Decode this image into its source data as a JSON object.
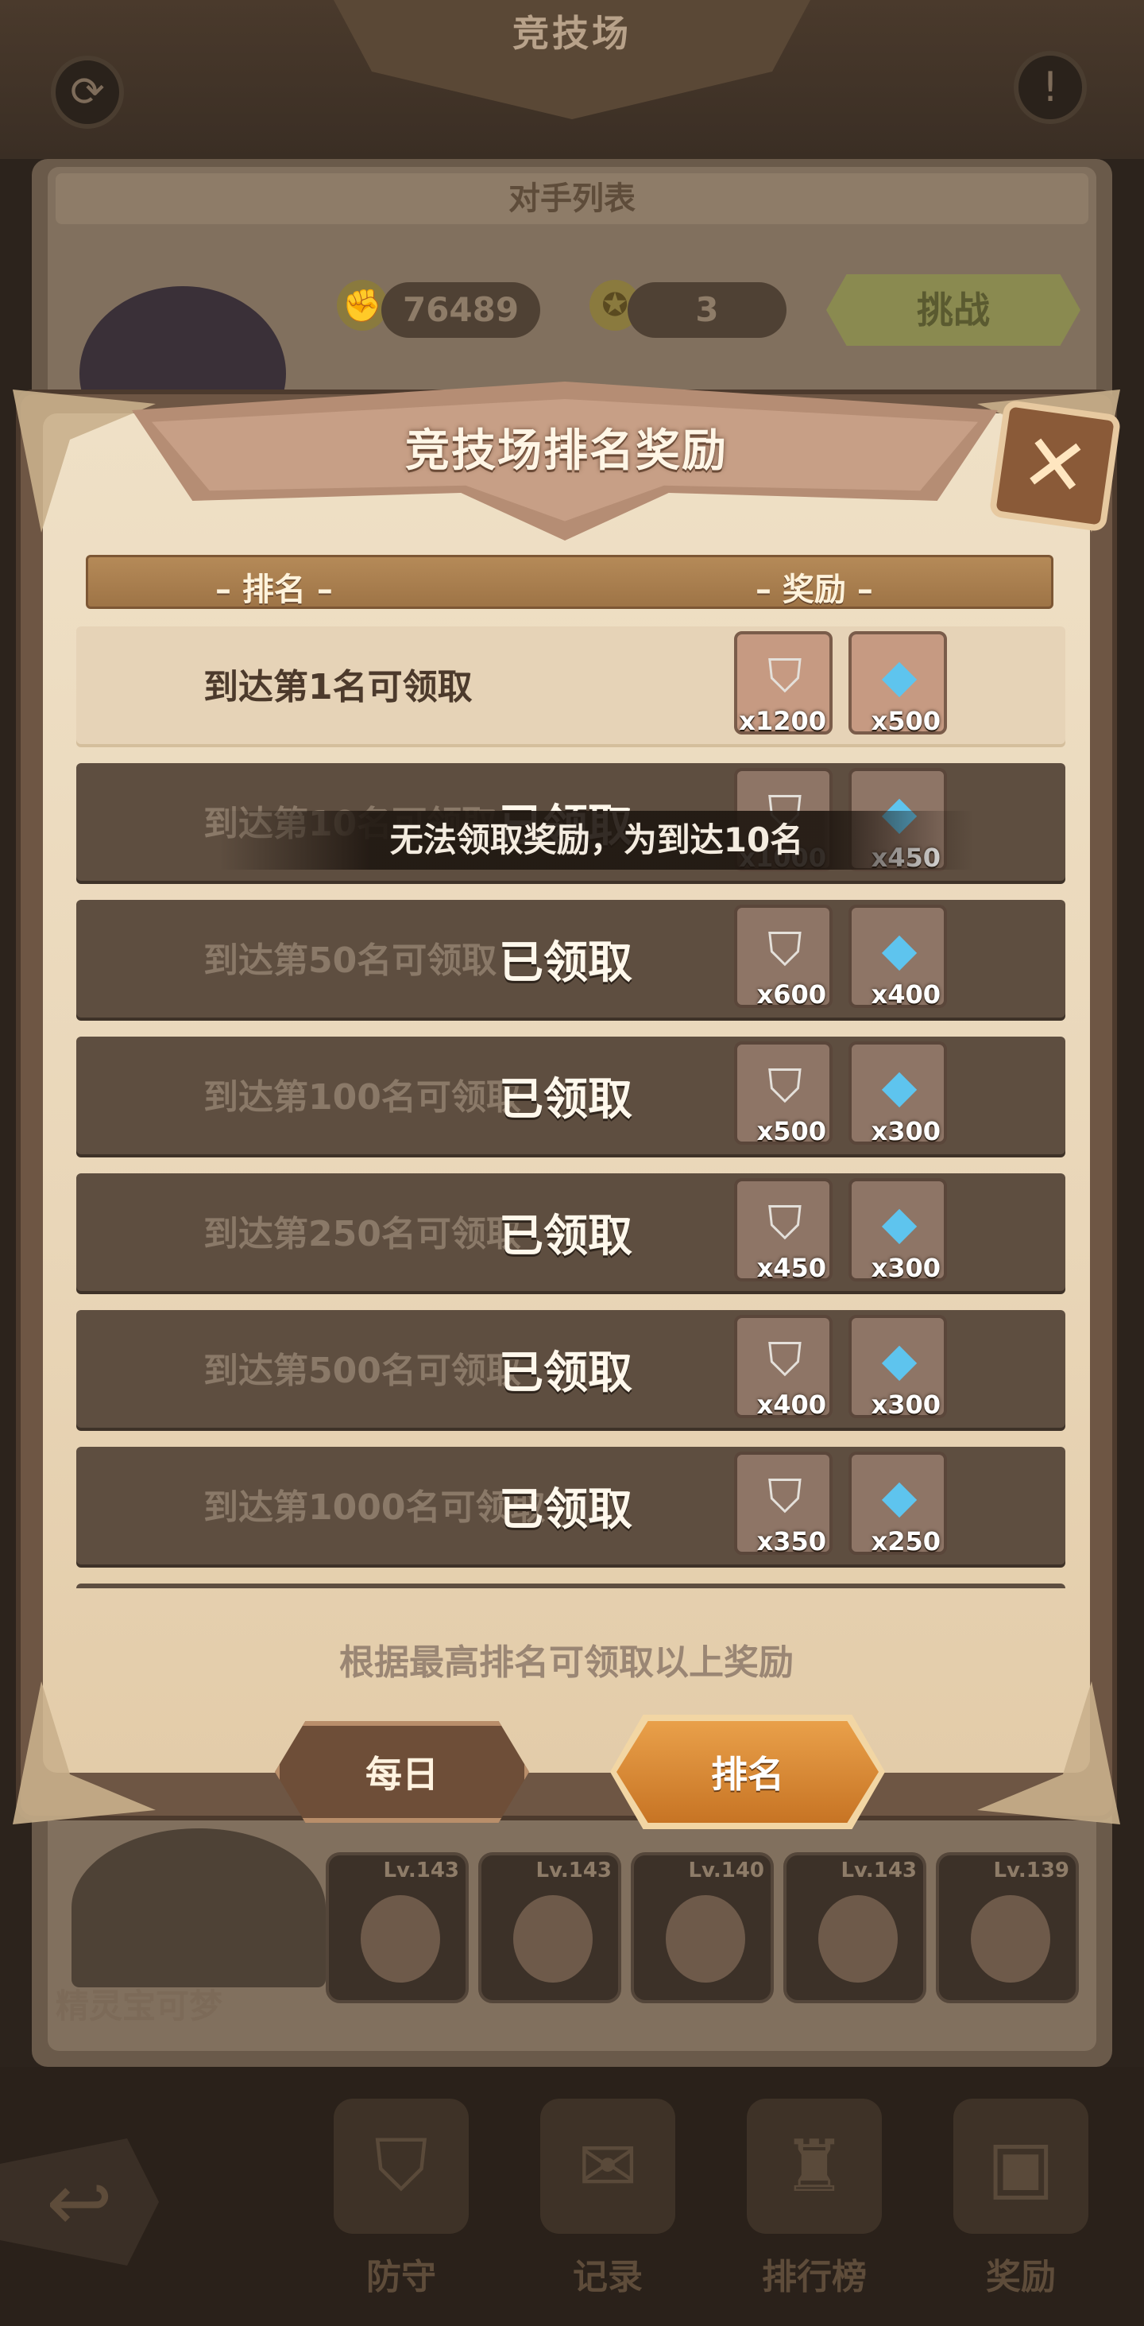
{
  "background": {
    "screen_title": "竞技场",
    "list_header": "对手列表",
    "power": "76489",
    "medals": "3",
    "challenge_label": "挑战",
    "hero_name": "精灵宝可梦",
    "heroes": [
      {
        "level": "Lv.143"
      },
      {
        "level": "Lv.143"
      },
      {
        "level": "Lv.140"
      },
      {
        "level": "Lv.143"
      },
      {
        "level": "Lv.139"
      }
    ],
    "nav": [
      {
        "label": "防守",
        "icon": "shield-icon"
      },
      {
        "label": "记录",
        "icon": "scroll-icon"
      },
      {
        "label": "排行榜",
        "icon": "trophy-icon"
      },
      {
        "label": "奖励",
        "icon": "chest-icon"
      }
    ]
  },
  "modal": {
    "title": "竞技场排名奖励",
    "col_rank": "– 排名 –",
    "col_reward": "– 奖励 –",
    "claimed_label": "已领取",
    "rows": [
      {
        "text": "到达第1名可领取",
        "status": "available",
        "r1": "x1200",
        "r2": "x500"
      },
      {
        "text": "到达第10名可领取",
        "status": "claimed",
        "r1": "x1000",
        "r2": "x450"
      },
      {
        "text": "到达第50名可领取",
        "status": "claimed",
        "r1": "x600",
        "r2": "x400"
      },
      {
        "text": "到达第100名可领取",
        "status": "claimed",
        "r1": "x500",
        "r2": "x300"
      },
      {
        "text": "到达第250名可领取",
        "status": "claimed",
        "r1": "x450",
        "r2": "x300"
      },
      {
        "text": "到达第500名可领取",
        "status": "claimed",
        "r1": "x400",
        "r2": "x300"
      },
      {
        "text": "到达第1000名可领取",
        "status": "claimed",
        "r1": "x350",
        "r2": "x250"
      }
    ],
    "toast": "无法领取奖励，为到达10名",
    "footnote": "根据最高排名可领取以上奖励",
    "tabs": {
      "daily": "每日",
      "rank": "排名"
    },
    "colors": {
      "accent": "#d7873a",
      "claimed_row": "#5e4e40",
      "available_row": "#e6d3b7"
    }
  }
}
